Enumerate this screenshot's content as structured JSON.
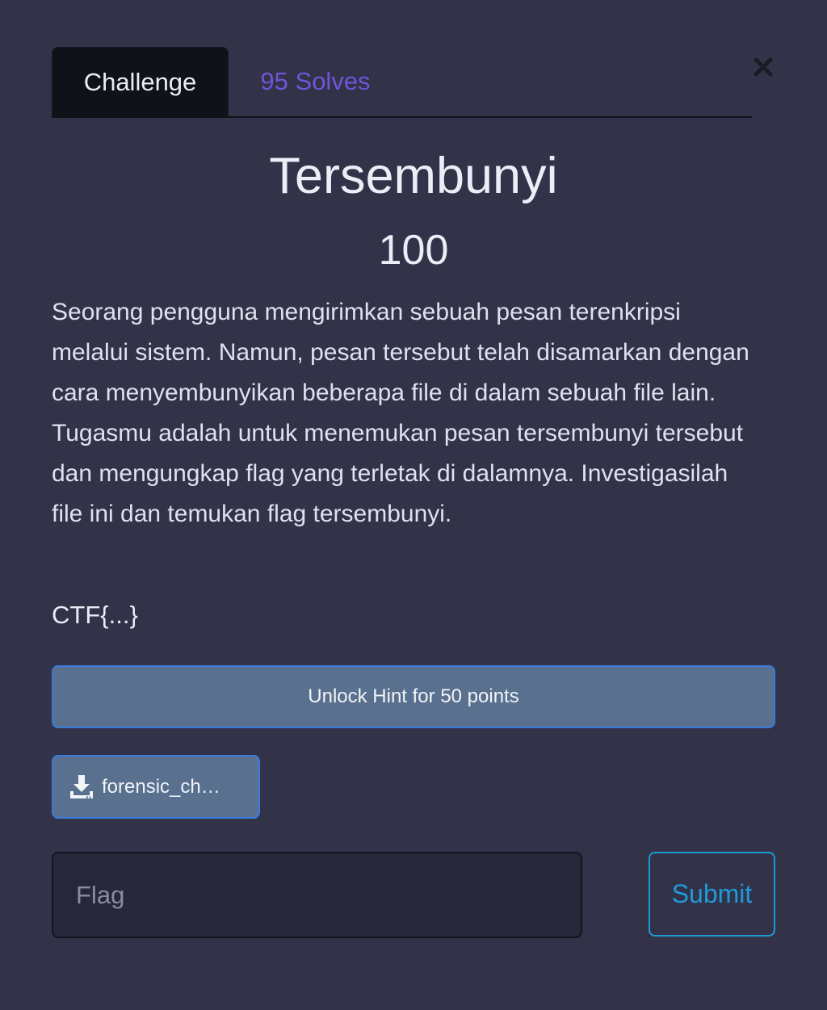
{
  "tabs": {
    "challenge": "Challenge",
    "solves": "95 Solves"
  },
  "close_icon": "close-icon",
  "challenge": {
    "name": "Tersembunyi",
    "points": "100",
    "description": "Seorang pengguna mengirimkan sebuah pesan terenkripsi melalui sistem. Namun, pesan tersebut telah disamarkan dengan cara menyembunyikan beberapa file di dalam sebuah file lain. Tugasmu adalah untuk menemukan pesan tersembunyi tersebut dan mengungkap flag yang terletak di dalamnya. Investigasilah file ini dan temukan flag tersembunyi.",
    "flag_format": "CTF{...}"
  },
  "hint": {
    "label": "Unlock Hint for 50 points"
  },
  "file": {
    "icon": "download-icon",
    "name": "forensic_ch…"
  },
  "flag_input": {
    "value": "",
    "placeholder": "Flag"
  },
  "submit": {
    "label": "Submit"
  },
  "colors": {
    "background": "#323249",
    "tab_active": "#11111a",
    "solves_link": "#6f55d8",
    "button_bg": "#59718f",
    "button_border": "#3b7be0",
    "submit": "#1f9ad8"
  }
}
